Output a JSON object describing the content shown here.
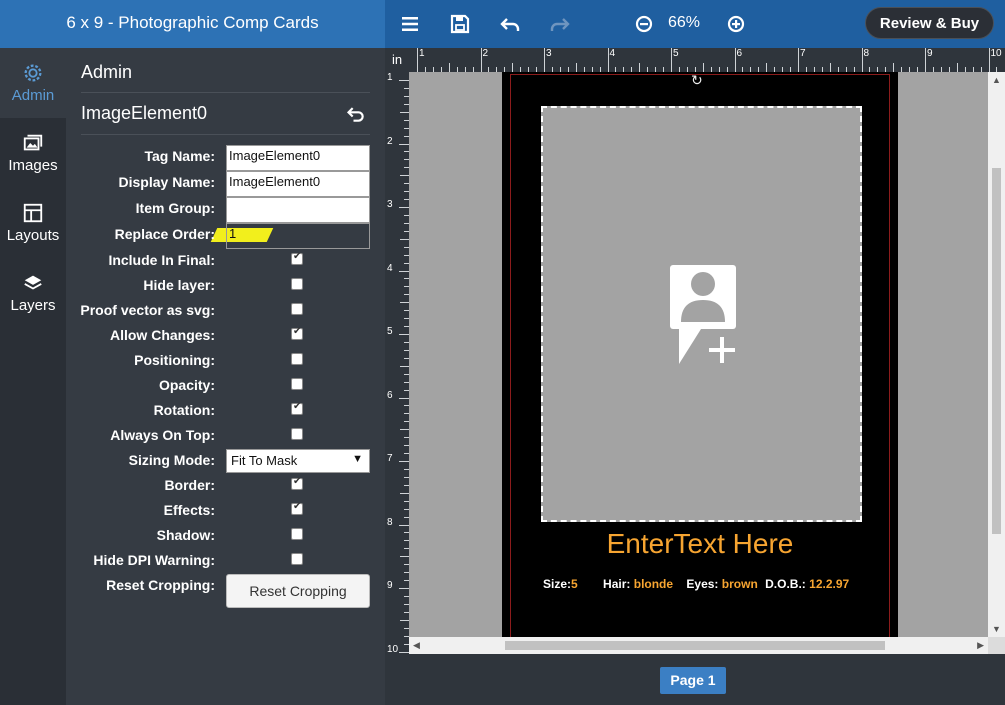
{
  "header": {
    "title": "6 x 9 - Photographic Comp Cards",
    "zoom_level": "66%",
    "review_buy_label": "Review & Buy"
  },
  "rail": {
    "items": [
      {
        "label": "Admin",
        "icon": "gear-icon"
      },
      {
        "label": "Images",
        "icon": "images-icon"
      },
      {
        "label": "Layouts",
        "icon": "layouts-icon"
      },
      {
        "label": "Layers",
        "icon": "layers-icon"
      }
    ]
  },
  "panel": {
    "title": "Admin",
    "element_name": "ImageElement0",
    "fields": {
      "tag_name": {
        "label": "Tag Name:",
        "value": "ImageElement0"
      },
      "display_name": {
        "label": "Display Name:",
        "value": "ImageElement0"
      },
      "item_group": {
        "label": "Item Group:",
        "value": ""
      },
      "replace_order": {
        "label": "Replace Order:",
        "value": "1"
      },
      "include_in_final": {
        "label": "Include In Final:",
        "checked": true
      },
      "hide_layer": {
        "label": "Hide layer:",
        "checked": false
      },
      "proof_vector": {
        "label": "Proof vector as svg:",
        "checked": false
      },
      "allow_changes": {
        "label": "Allow Changes:",
        "checked": true
      },
      "positioning": {
        "label": "Positioning:",
        "checked": false
      },
      "opacity": {
        "label": "Opacity:",
        "checked": false
      },
      "rotation": {
        "label": "Rotation:",
        "checked": true
      },
      "always_on_top": {
        "label": "Always On Top:",
        "checked": false
      },
      "sizing_mode": {
        "label": "Sizing Mode:",
        "value": "Fit To Mask"
      },
      "border": {
        "label": "Border:",
        "checked": true
      },
      "effects": {
        "label": "Effects:",
        "checked": true
      },
      "shadow": {
        "label": "Shadow:",
        "checked": false
      },
      "hide_dpi": {
        "label": "Hide DPI Warning:",
        "checked": false
      },
      "reset_cropping": {
        "label": "Reset Cropping:",
        "button": "Reset Cropping"
      }
    }
  },
  "ruler": {
    "unit": "in",
    "top_numbers": [
      "1",
      "2",
      "3",
      "4",
      "5",
      "6",
      "7",
      "8",
      "9",
      "10"
    ],
    "left_numbers": [
      "1",
      "2",
      "3",
      "4",
      "5",
      "6",
      "7",
      "8",
      "9",
      "10"
    ]
  },
  "card": {
    "headline": "EnterText Here",
    "size_label": "Size:",
    "size_value": "5",
    "hair_label": "Hair:",
    "hair_value": "blonde",
    "eyes_label": "Eyes:",
    "eyes_value": "brown",
    "dob_label": "D.O.B.:",
    "dob_value": "12.2.97"
  },
  "footer": {
    "page_label": "Page 1"
  },
  "colors": {
    "header_bg": "#1f5fa0",
    "accent": "#3b7fc4",
    "card_text_accent": "#f7a531",
    "highlight": "#f2ef1c"
  }
}
